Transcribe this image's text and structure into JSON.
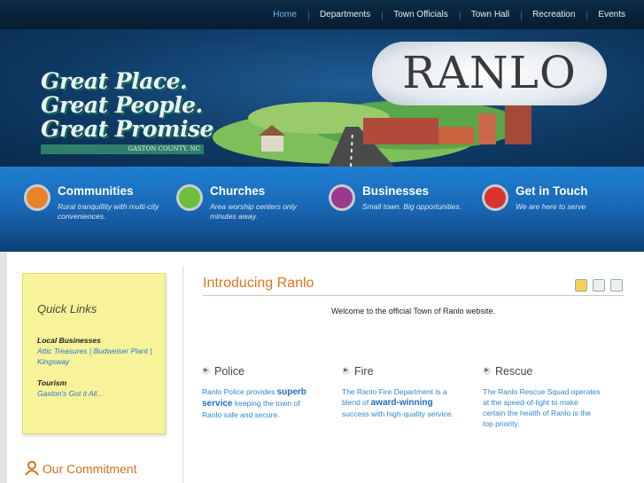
{
  "nav": {
    "items": [
      "Home",
      "Departments",
      "Town Officials",
      "Town Hall",
      "Recreation",
      "Events"
    ]
  },
  "banner": {
    "tagline": [
      "Great Place.",
      "Great People.",
      "Great Promise."
    ],
    "county": "GASTON COUNTY, NC",
    "logo": "RANLO"
  },
  "features": [
    {
      "title": "Communities",
      "desc": "Rural tranquillity with multi-city conveniences.",
      "color": "#e8832a",
      "icon": "check-icon"
    },
    {
      "title": "Churches",
      "desc": "Area worship centers only minutes away.",
      "color": "#6cbf3c",
      "icon": "arrow-right-icon"
    },
    {
      "title": "Businesses",
      "desc": "Small town. Big opportunities.",
      "color": "#9a3a8a",
      "icon": "card-icon"
    },
    {
      "title": "Get in Touch",
      "desc": "We are here to serve",
      "color": "#d9332b",
      "icon": "phone-icon"
    }
  ],
  "quick_links": {
    "heading": "Quick Links",
    "sections": [
      {
        "title": "Local Businesses",
        "links": "Attic Treasures | Budweiser Plant | Kingsway"
      },
      {
        "title": "Tourism",
        "links": "Gaston's Got it All..."
      }
    ]
  },
  "commitment": "Our Commitment",
  "main": {
    "title": "Introducing Ranlo",
    "welcome": "Welcome to the official Town of Ranlo website.",
    "columns": [
      {
        "heading": "Police",
        "pre": "Ranlo Police provides ",
        "bold": "superb service",
        "post": " keeping the town of Ranlo safe and secure."
      },
      {
        "heading": "Fire",
        "pre": "The Ranlo Fire Department is a blend of ",
        "bold": "award-winning",
        "post": " success with high-quality service."
      },
      {
        "heading": "Rescue",
        "pre": "The Ranlo Rescue Squad operates at the speed-of-light to make certain the health of Ranlo is the top priority.",
        "bold": "",
        "post": ""
      }
    ]
  }
}
